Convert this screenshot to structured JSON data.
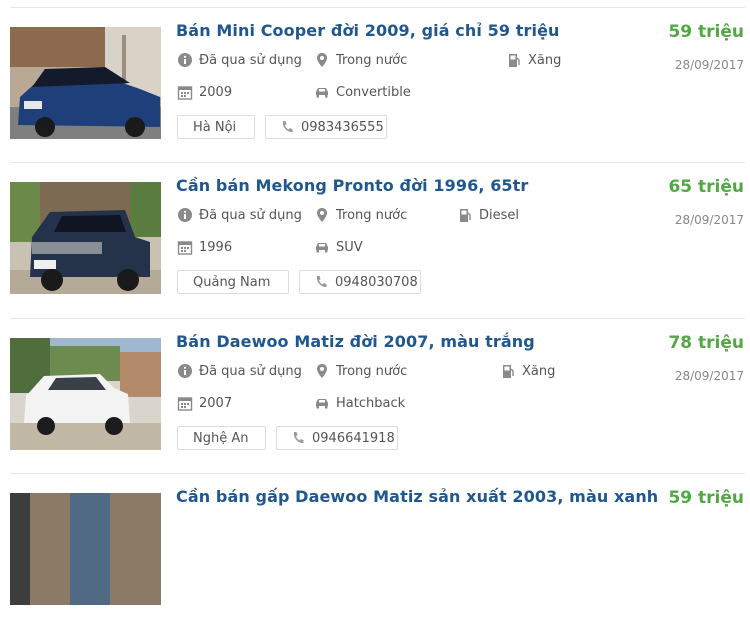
{
  "listings": [
    {
      "title": "Bán Mini Cooper đời 2009, giá chỉ 59 triệu",
      "price": "59 triệu",
      "date": "28/09/2017",
      "condition": "Đã qua sử dụng",
      "origin": "Trong nước",
      "fuel": "Xăng",
      "year": "2009",
      "body": "Convertible",
      "location": "Hà Nội",
      "phone": "0983436555"
    },
    {
      "title": "Cần bán Mekong Pronto đời 1996, 65tr",
      "price": "65 triệu",
      "date": "28/09/2017",
      "condition": "Đã qua sử dụng",
      "origin": "Trong nước",
      "fuel": "Diesel",
      "year": "1996",
      "body": "SUV",
      "location": "Quảng Nam",
      "phone": "0948030708"
    },
    {
      "title": "Bán Daewoo Matiz đời 2007, màu trắng",
      "price": "78 triệu",
      "date": "28/09/2017",
      "condition": "Đã qua sử dụng",
      "origin": "Trong nước",
      "fuel": "Xăng",
      "year": "2007",
      "body": "Hatchback",
      "location": "Nghệ An",
      "phone": "0946641918"
    },
    {
      "title": "Cần bán gấp Daewoo Matiz sản xuất 2003, màu xanh",
      "price": "59 triệu"
    }
  ],
  "colors": {
    "title": "#21578f",
    "price": "#52a845",
    "meta": "#555555",
    "icon": "#8a8a8a"
  },
  "icons": {
    "condition": "info-circle-icon",
    "origin": "map-marker-icon",
    "fuel": "fuel-pump-icon",
    "year": "calendar-icon",
    "body": "car-icon",
    "phone": "phone-icon"
  }
}
